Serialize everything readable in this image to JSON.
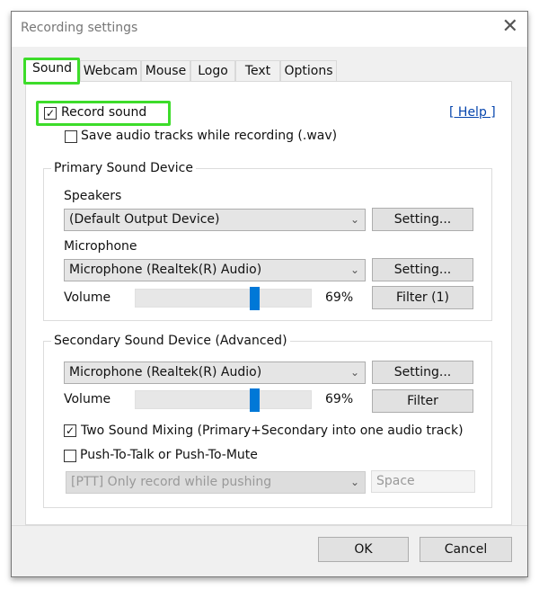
{
  "window": {
    "title": "Recording settings",
    "close_icon": "close-icon"
  },
  "tabs": [
    {
      "label": "Sound",
      "active": true
    },
    {
      "label": "Webcam"
    },
    {
      "label": "Mouse"
    },
    {
      "label": "Logo"
    },
    {
      "label": "Text"
    },
    {
      "label": "Options"
    }
  ],
  "highlight_color": "#3ddc2a",
  "sound": {
    "record_sound": {
      "label": "Record sound",
      "checked": true
    },
    "help": "[ Help ]",
    "save_wav": {
      "label": "Save audio tracks while recording (.wav)",
      "checked": false
    },
    "primary": {
      "legend": "Primary Sound Device",
      "speakers_label": "Speakers",
      "speakers_value": "(Default Output Device)",
      "speakers_setting": "Setting...",
      "mic_label": "Microphone",
      "mic_value": "Microphone (Realtek(R) Audio)",
      "mic_setting": "Setting...",
      "volume_label": "Volume",
      "volume_percent": 69,
      "volume_text": "69%",
      "filter": "Filter (1)"
    },
    "secondary": {
      "legend": "Secondary Sound Device (Advanced)",
      "mic_value": "Microphone (Realtek(R) Audio)",
      "mic_setting": "Setting...",
      "volume_label": "Volume",
      "volume_percent": 69,
      "volume_text": "69%",
      "filter": "Filter",
      "two_mix": {
        "label": "Two Sound Mixing (Primary+Secondary into one audio track)",
        "checked": true
      },
      "ptt": {
        "label": "Push-To-Talk or Push-To-Mute",
        "checked": false
      },
      "ptt_mode": "[PTT] Only record while pushing",
      "ptt_key": "Space"
    }
  },
  "footer": {
    "ok": "OK",
    "cancel": "Cancel"
  },
  "accent": "#0078d7"
}
